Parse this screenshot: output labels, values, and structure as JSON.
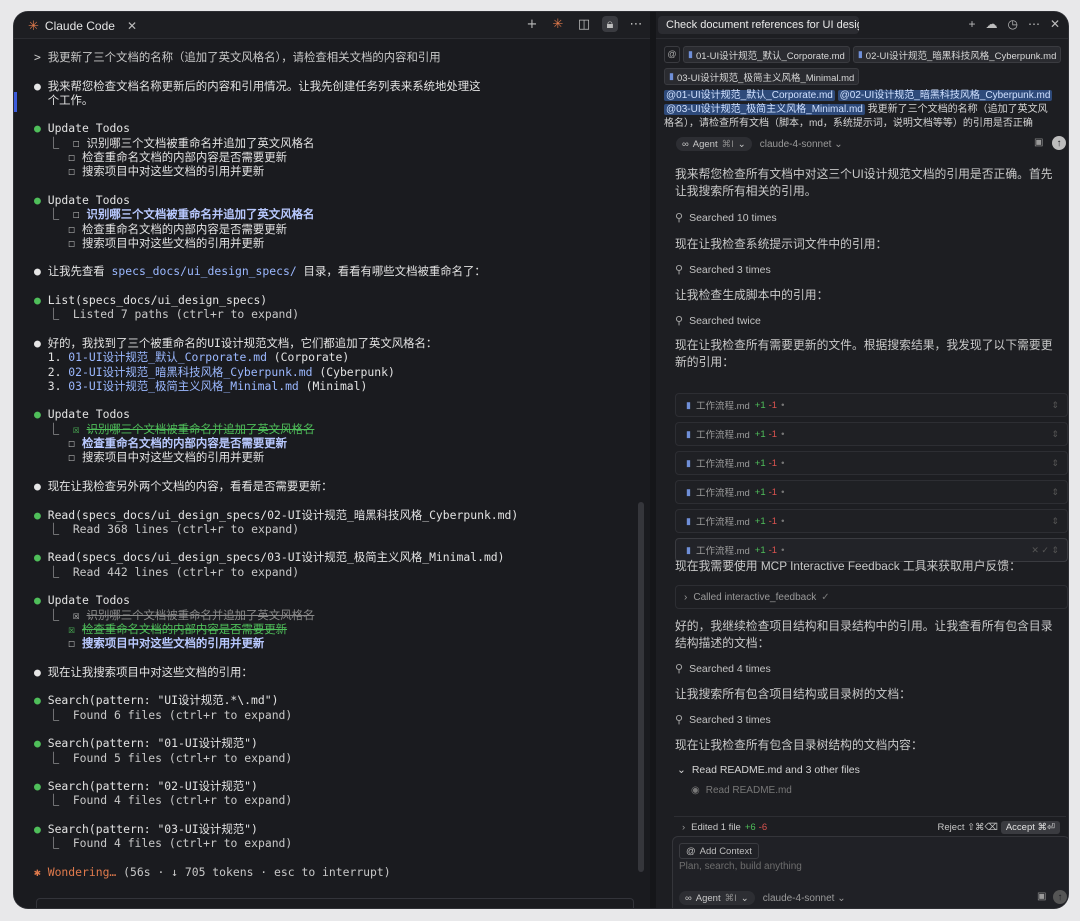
{
  "left": {
    "tab_title": "Claude Code",
    "lines": [
      {
        "k": "prompt",
        "t": "> 我更新了三个文档的名称（追加了英文风格名），请检查相关文档的内容和引用"
      },
      {
        "k": "gap"
      },
      {
        "k": "white",
        "t": "我来帮您检查文档名称更新后的内容和引用情况。让我先创建任务列表来系统地处理这"
      },
      {
        "k": "cont",
        "t": "个工作。"
      },
      {
        "k": "gap"
      },
      {
        "k": "green",
        "t": "Update Todos"
      },
      {
        "k": "sub",
        "b": "☐",
        "t": "识别哪三个文档被重命名并追加了英文风格名"
      },
      {
        "k": "sub2",
        "b": "☐",
        "t": "检查重命名文档的内部内容是否需要更新"
      },
      {
        "k": "sub2",
        "b": "☐",
        "t": "搜索项目中对这些文档的引用并更新"
      },
      {
        "k": "gap"
      },
      {
        "k": "green",
        "t": "Update Todos"
      },
      {
        "k": "sub",
        "b": "☐",
        "t": "识别哪三个文档被重命名并追加了英文风格名",
        "s": "bold"
      },
      {
        "k": "sub2",
        "b": "☐",
        "t": "检查重命名文档的内部内容是否需要更新"
      },
      {
        "k": "sub2",
        "b": "☐",
        "t": "搜索项目中对这些文档的引用并更新"
      },
      {
        "k": "gap"
      },
      {
        "k": "white",
        "t": "让我先查看 ",
        "a": "specs_docs/ui_design_specs/",
        "c": " 目录，看看有哪些文档被重命名了："
      },
      {
        "k": "gap"
      },
      {
        "k": "green",
        "t": "List(specs_docs/ui_design_specs)"
      },
      {
        "k": "result",
        "t": "Listed 7 paths (ctrl+r to expand)"
      },
      {
        "k": "gap"
      },
      {
        "k": "white",
        "t": "好的，我找到了三个被重命名的UI设计规范文档，它们都追加了英文风格名："
      },
      {
        "k": "num",
        "n": "1.",
        "a": "01-UI设计规范_默认_Corporate.md",
        "c": " (Corporate)"
      },
      {
        "k": "num",
        "n": "2.",
        "a": "02-UI设计规范_暗黑科技风格_Cyberpunk.md",
        "c": " (Cyberpunk)"
      },
      {
        "k": "num",
        "n": "3.",
        "a": "03-UI设计规范_极简主义风格_Minimal.md",
        "c": " (Minimal)"
      },
      {
        "k": "gap"
      },
      {
        "k": "green",
        "t": "Update Todos"
      },
      {
        "k": "sub",
        "b": "☒",
        "t": "识别哪三个文档被重命名并追加了英文风格名",
        "s": "done"
      },
      {
        "k": "sub2",
        "b": "☐",
        "t": "检查重命名文档的内部内容是否需要更新",
        "s": "bold"
      },
      {
        "k": "sub2",
        "b": "☐",
        "t": "搜索项目中对这些文档的引用并更新"
      },
      {
        "k": "gap"
      },
      {
        "k": "white",
        "t": "现在让我检查另外两个文档的内容，看看是否需要更新："
      },
      {
        "k": "gap"
      },
      {
        "k": "green",
        "t": "Read(specs_docs/ui_design_specs/02-UI设计规范_暗黑科技风格_Cyberpunk.md)"
      },
      {
        "k": "result",
        "t": "Read 368 lines (ctrl+r to expand)"
      },
      {
        "k": "gap"
      },
      {
        "k": "green",
        "t": "Read(specs_docs/ui_design_specs/03-UI设计规范_极简主义风格_Minimal.md)"
      },
      {
        "k": "result",
        "t": "Read 442 lines (ctrl+r to expand)"
      },
      {
        "k": "gap"
      },
      {
        "k": "green",
        "t": "Update Todos"
      },
      {
        "k": "sub",
        "b": "☒",
        "t": "识别哪三个文档被重命名并追加了英文风格名",
        "s": "donedim"
      },
      {
        "k": "sub2",
        "b": "☒",
        "t": "检查重命名文档的内部内容是否需要更新",
        "s": "done"
      },
      {
        "k": "sub2",
        "b": "☐",
        "t": "搜索项目中对这些文档的引用并更新",
        "s": "bold"
      },
      {
        "k": "gap"
      },
      {
        "k": "white",
        "t": "现在让我搜索项目中对这些文档的引用："
      },
      {
        "k": "gap"
      },
      {
        "k": "green",
        "t": "Search(pattern: \"UI设计规范.*\\.md\")"
      },
      {
        "k": "result",
        "t": "Found 6 files (ctrl+r to expand)"
      },
      {
        "k": "gap"
      },
      {
        "k": "green",
        "t": "Search(pattern: \"01-UI设计规范\")"
      },
      {
        "k": "result",
        "t": "Found 5 files (ctrl+r to expand)"
      },
      {
        "k": "gap"
      },
      {
        "k": "green",
        "t": "Search(pattern: \"02-UI设计规范\")"
      },
      {
        "k": "result",
        "t": "Found 4 files (ctrl+r to expand)"
      },
      {
        "k": "gap"
      },
      {
        "k": "green",
        "t": "Search(pattern: \"03-UI设计规范\")"
      },
      {
        "k": "result",
        "t": "Found 4 files (ctrl+r to expand)"
      },
      {
        "k": "gap"
      },
      {
        "k": "status",
        "a": "✱ Wondering…",
        "c": " (56s · ↓ 705 tokens · esc to interrupt)"
      }
    ]
  },
  "right": {
    "tab_title": "Check document references for UI design",
    "chips": [
      "01-UI设计规范_默认_Corporate.md",
      "02-UI设计规范_暗黑科技风格_Cyberpunk.md",
      "03-UI设计规范_极简主义风格_Minimal.md"
    ],
    "mentions": [
      "@01-UI设计规范_默认_Corporate.md",
      "@02-UI设计规范_暗黑科技风格_Cyberpunk.md",
      "@03-UI设计规范_极简主义风格_Minimal.md"
    ],
    "ctx_text": " 我更新了三个文档的名称（追加了英文风格名），请检查所有文档（脚本，md，系统提示词，说明文档等等）的引用是否正确",
    "agent_label": "Agent",
    "agent_shortcut": "⌘I",
    "model": "claude-4-sonnet",
    "msg1": "我来帮您检查所有文档中对这三个UI设计规范文档的引用是否正确。首先让我搜索所有相关的引用。",
    "s1": "Searched 10 times",
    "msg2": "现在让我检查系统提示词文件中的引用：",
    "s2": "Searched 3 times",
    "msg3": "让我检查生成脚本中的引用：",
    "s3": "Searched twice",
    "msg4": "现在让我检查所有需要更新的文件。根据搜索结果，我发现了以下需要更新的引用：",
    "file_name": "工作流程.md",
    "file_plus": "+1",
    "file_minus": "-1",
    "msg5": "现在我需要使用 MCP Interactive Feedback 工具来获取用户反馈：",
    "called": "Called interactive_feedback",
    "msg6": "好的，我继续检查项目结构和目录结构中的引用。让我查看所有包含目录结构描述的文档：",
    "s4": "Searched 4 times",
    "msg7": "让我搜索所有包含项目结构或目录树的文档：",
    "s5": "Searched 3 times",
    "msg8": "现在让我检查所有包含目录树结构的文档内容：",
    "read_hdr": "Read README.md and 3 other files",
    "read_sub": "Read README.md",
    "edited": "Edited 1 file",
    "edited_plus": "+6",
    "edited_minus": "-6",
    "reject": "Reject ⇧⌘⌫",
    "accept": "Accept ⌘⏎",
    "add_context": "Add Context",
    "placeholder": "Plan, search, build anything"
  }
}
